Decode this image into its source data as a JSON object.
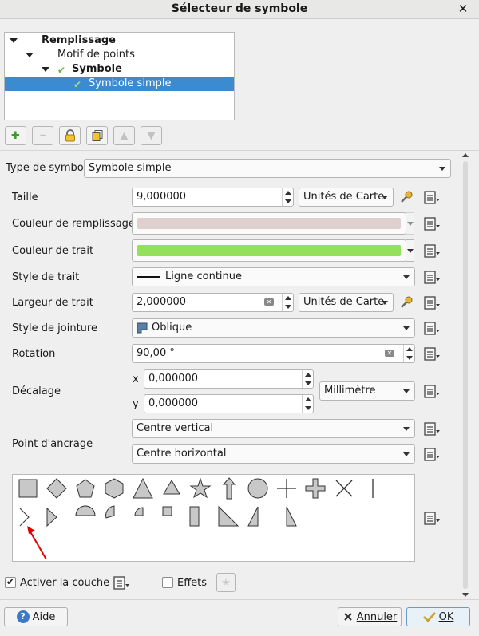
{
  "window": {
    "title": "Sélecteur de symbole",
    "close_glyph": "✕"
  },
  "tree": {
    "items": [
      {
        "label": "Remplissage",
        "bold": true
      },
      {
        "label": "Motif de points",
        "bold": false
      },
      {
        "label": "Symbole",
        "bold": true
      },
      {
        "label": "Symbole simple",
        "bold": false,
        "selected": true
      }
    ]
  },
  "toolbar": {
    "buttons": [
      {
        "name": "add-layer-icon",
        "glyph": "✚",
        "enabled": true
      },
      {
        "name": "remove-layer-icon",
        "glyph": "━",
        "enabled": false
      },
      {
        "name": "lock-icon",
        "glyph": "🔒",
        "enabled": true
      },
      {
        "name": "duplicate-icon",
        "glyph": "⧉",
        "enabled": true
      },
      {
        "name": "move-up-icon",
        "glyph": "▲",
        "enabled": false
      },
      {
        "name": "move-down-icon",
        "glyph": "▼",
        "enabled": false
      }
    ]
  },
  "symbol_type": {
    "label": "Type de symbole",
    "value": "Symbole simple"
  },
  "props": {
    "size": {
      "label": "Taille",
      "value": "9,000000",
      "unit": "Unités de Carte"
    },
    "fill_color": {
      "label": "Couleur de remplissage",
      "color": "#ddd0cf"
    },
    "stroke_color": {
      "label": "Couleur de trait",
      "color": "#93e15a"
    },
    "stroke_style": {
      "label": "Style de trait",
      "value": "Ligne continue"
    },
    "stroke_width": {
      "label": "Largeur de trait",
      "value": "2,000000",
      "unit": "Unités de Carte"
    },
    "join_style": {
      "label": "Style de jointure",
      "value": "Oblique"
    },
    "rotation": {
      "label": "Rotation",
      "value": "90,00 °"
    },
    "offset": {
      "label": "Décalage",
      "x_label": "x",
      "x_value": "0,000000",
      "y_label": "y",
      "y_value": "0,000000",
      "unit": "Millimètre"
    },
    "anchor": {
      "label": "Point d'ancrage",
      "vertical": "Centre vertical",
      "horizontal": "Centre horizontal"
    }
  },
  "shapes": {
    "row1": [
      "square",
      "diamond",
      "pentagon",
      "hexagon",
      "triangle",
      "equilateral-triangle",
      "star",
      "arrow",
      "circle",
      "cross",
      "cross-fill",
      "cross2",
      "line"
    ],
    "row2": [
      "arrowhead",
      "filled-arrowhead",
      "semicircle",
      "third-circle",
      "quarter-circle",
      "quarter-square",
      "half-square",
      "diagonal-half-square",
      "right-half-triangle",
      "left-half-triangle"
    ]
  },
  "footer": {
    "enable_layer_label": "Activer la couche",
    "enable_layer_checked": true,
    "effects_label": "Effets",
    "effects_checked": false,
    "help_label": "Aide",
    "cancel_label": "Annuler",
    "ok_label": "OK"
  },
  "colors": {
    "selection": "#3c8ad0",
    "check_green": "#62b435",
    "arrow_red": "#e00000"
  }
}
